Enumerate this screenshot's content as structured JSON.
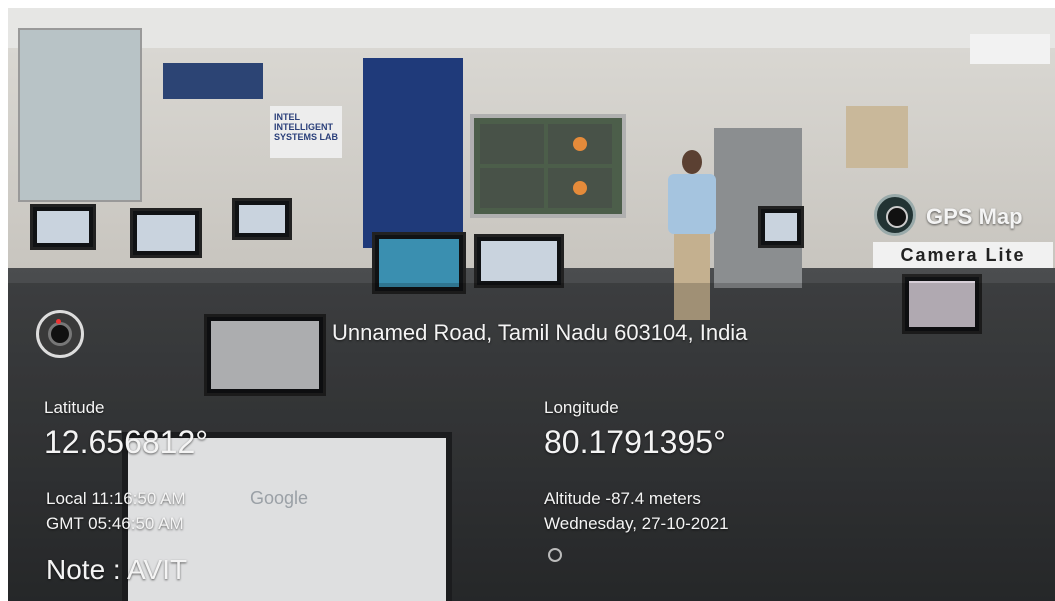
{
  "badge": {
    "title": "GPS Map",
    "subtitle": "Camera Lite",
    "icon": "camera-lens-icon"
  },
  "overlay": {
    "icon": "camera-shutter-icon",
    "address": "Unnamed Road, Tamil Nadu 603104, India",
    "latitude_label": "Latitude",
    "latitude_value": "12.656812°",
    "longitude_label": "Longitude",
    "longitude_value": "80.1791395°",
    "local_time": "Local 11:16:50 AM",
    "gmt_time": "GMT 05:46:50 AM",
    "altitude": "Altitude -87.4 meters",
    "date": "Wednesday, 27-10-2021",
    "note": "Note : AVIT"
  },
  "photo": {
    "sign_text": "INTEL INTELLIGENT SYSTEMS LAB",
    "monitor_logo": "Google"
  }
}
